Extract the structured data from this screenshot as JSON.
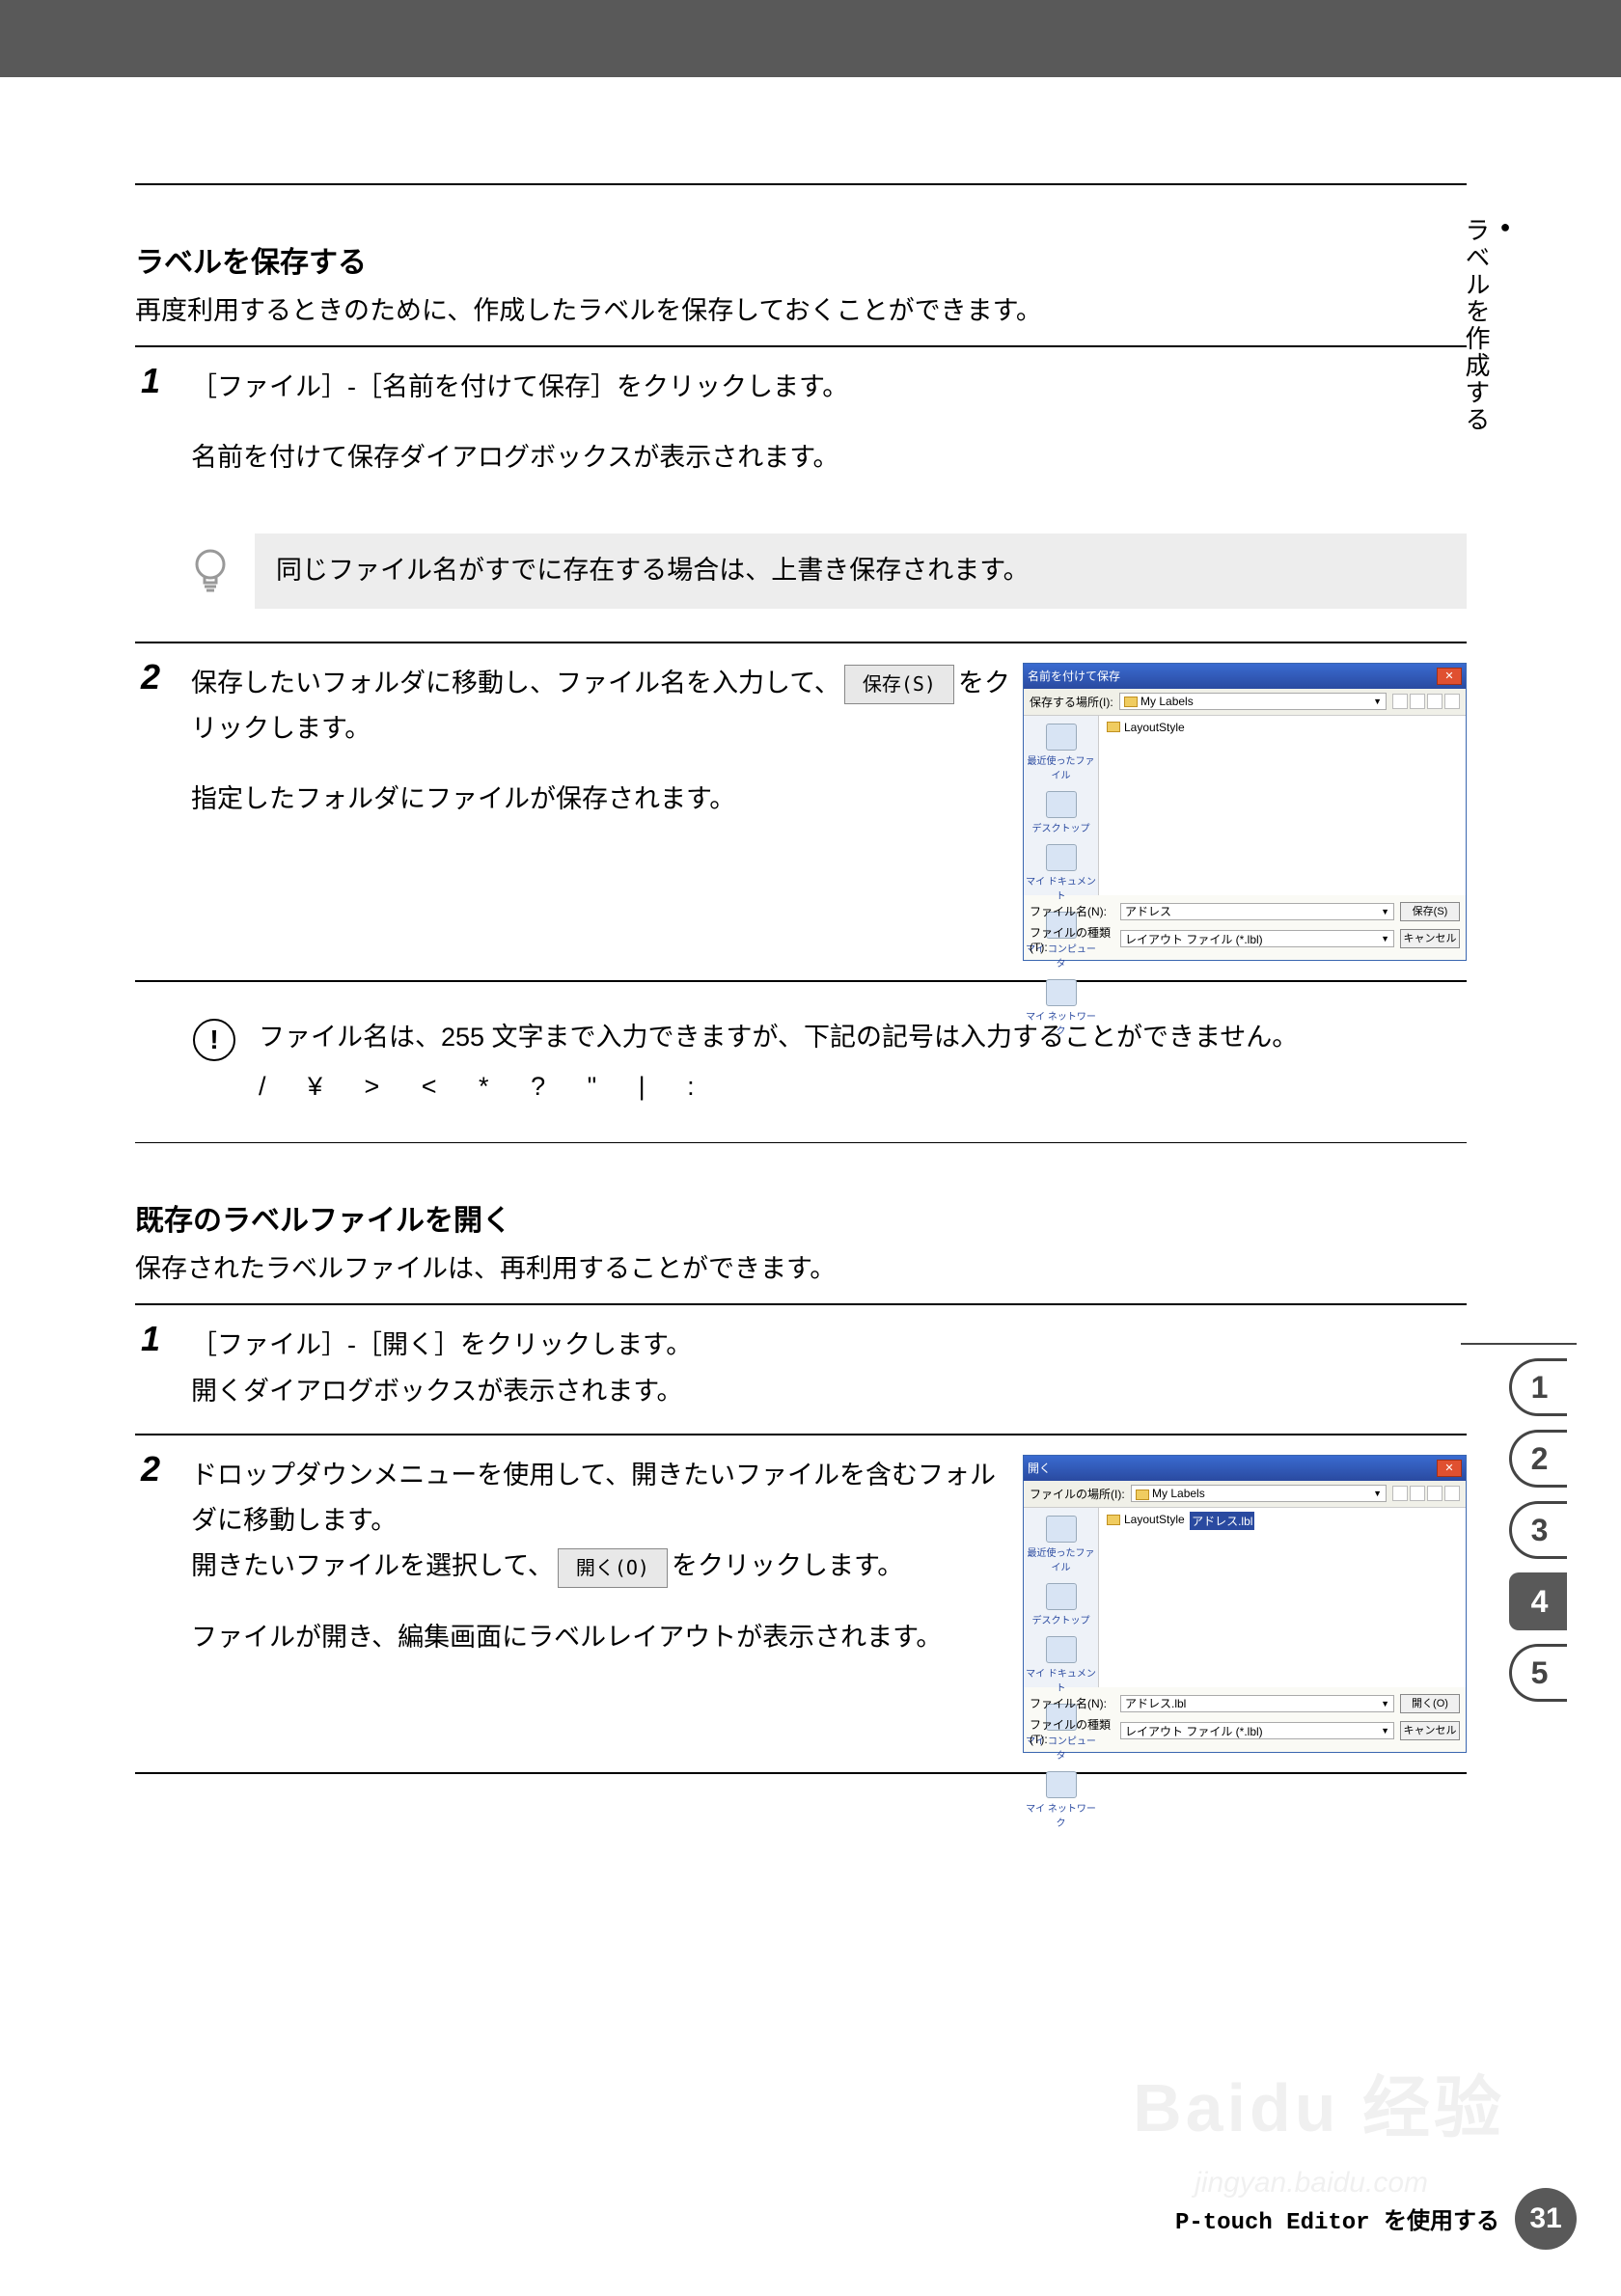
{
  "side_tab": "ラベルを作成する",
  "section1": {
    "title": "ラベルを保存する",
    "intro": "再度利用するときのために、作成したラベルを保存しておくことができます。",
    "step1": {
      "text": "［ファイル］-［名前を付けて保存］をクリックします。",
      "result": "名前を付けて保存ダイアログボックスが表示されます。"
    },
    "note": "同じファイル名がすでに存在する場合は、上書き保存されます。",
    "step2": {
      "text_a": "保存したいフォルダに移動し、ファイル名を入力して、",
      "btn": "保存(S)",
      "text_b": "をクリックします。",
      "result": "指定したフォルダにファイルが保存されます。"
    },
    "warn": {
      "line1": "ファイル名は、255 文字まで入力できますが、下記の記号は入力することができません。",
      "symbols": "/ ¥ > < * ? \" | :"
    }
  },
  "section2": {
    "title": "既存のラベルファイルを開く",
    "intro": "保存されたラベルファイルは、再利用することができます。",
    "step1": {
      "text": "［ファイル］-［開く］をクリックします。",
      "result": "開くダイアログボックスが表示されます。"
    },
    "step2": {
      "text_a": "ドロップダウンメニューを使用して、開きたいファイルを含むフォルダに移動します。",
      "text_b": "開きたいファイルを選択して、",
      "btn": "開く(O)",
      "text_c": "をクリックします。",
      "result": "ファイルが開き、編集画面にラベルレイアウトが表示されます。"
    }
  },
  "dialog": {
    "save_title": "名前を付けて保存",
    "open_title": "開く",
    "loc_label_save": "保存する場所(I):",
    "loc_label_open": "ファイルの場所(I):",
    "loc_value": "My Labels",
    "folder": "LayoutStyle",
    "side_items": [
      "最近使ったファイル",
      "デスクトップ",
      "マイ ドキュメント",
      "マイ コンピュータ",
      "マイ ネットワーク"
    ],
    "name_label": "ファイル名(N):",
    "name_save": "アドレス",
    "name_open": "アドレス.lbl",
    "type_label": "ファイルの種類(T):",
    "type_value": "レイアウト ファイル (*.lbl)",
    "btn_save": "保存(S)",
    "btn_open": "開く(O)",
    "btn_cancel": "キャンセル"
  },
  "tabs": [
    "1",
    "2",
    "3",
    "4",
    "5"
  ],
  "tab_active": "4",
  "footer": "P-touch Editor を使用する",
  "page_num": "31",
  "watermark1": "Baidu 经验",
  "watermark2": "jingyan.baidu.com"
}
